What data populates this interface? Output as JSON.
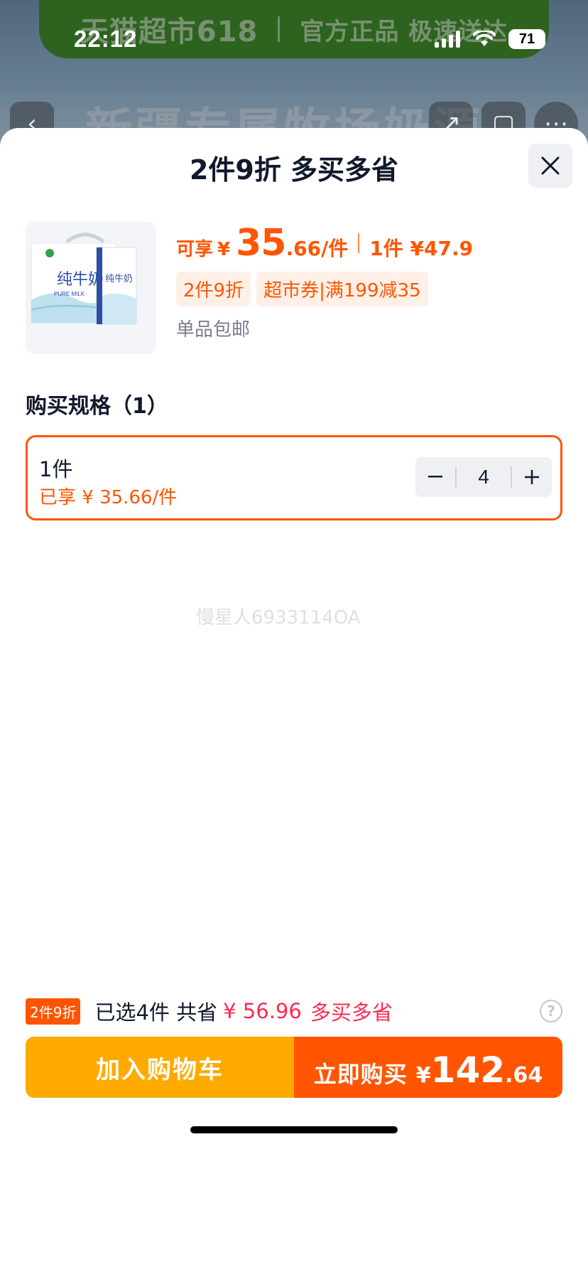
{
  "status_bar": {
    "time": "22:12",
    "battery": "71"
  },
  "background": {
    "banner_brand": "天猫超市618",
    "banner_slogan": "官方正品 极速送达",
    "headline": "新疆专属牧场奶源"
  },
  "sheet": {
    "title": "2件9折 多买多省",
    "close_icon": "close-icon"
  },
  "product": {
    "image_text_main": "纯牛奶",
    "image_text_en": "PURE MILK",
    "price_label": "可享",
    "currency": "¥",
    "price_int": "35",
    "price_dec": ".66/件",
    "single_price": "1件 ¥47.9",
    "tags": [
      "2件9折",
      "超市券|满199减35"
    ],
    "shipping": "单品包邮"
  },
  "spec": {
    "title": "购买规格（1）",
    "options": [
      {
        "name": "1件",
        "price_note": "已享 ¥ 35.66/件",
        "quantity": "4",
        "selected": true
      }
    ]
  },
  "watermark": "慢星人6933114OA",
  "summary": {
    "badge": "2件9折",
    "selected_text": "已选4件 共省",
    "saved_amount": "¥ 56.96",
    "promo": "多买多省"
  },
  "actions": {
    "add_to_cart": "加入购物车",
    "buy_now": "立即购买",
    "currency": "¥",
    "total_int": "142",
    "total_dec": ".64"
  },
  "colors": {
    "accent": "#ff5500",
    "cart": "#ffaa00",
    "savings": "#ff2a4e"
  }
}
